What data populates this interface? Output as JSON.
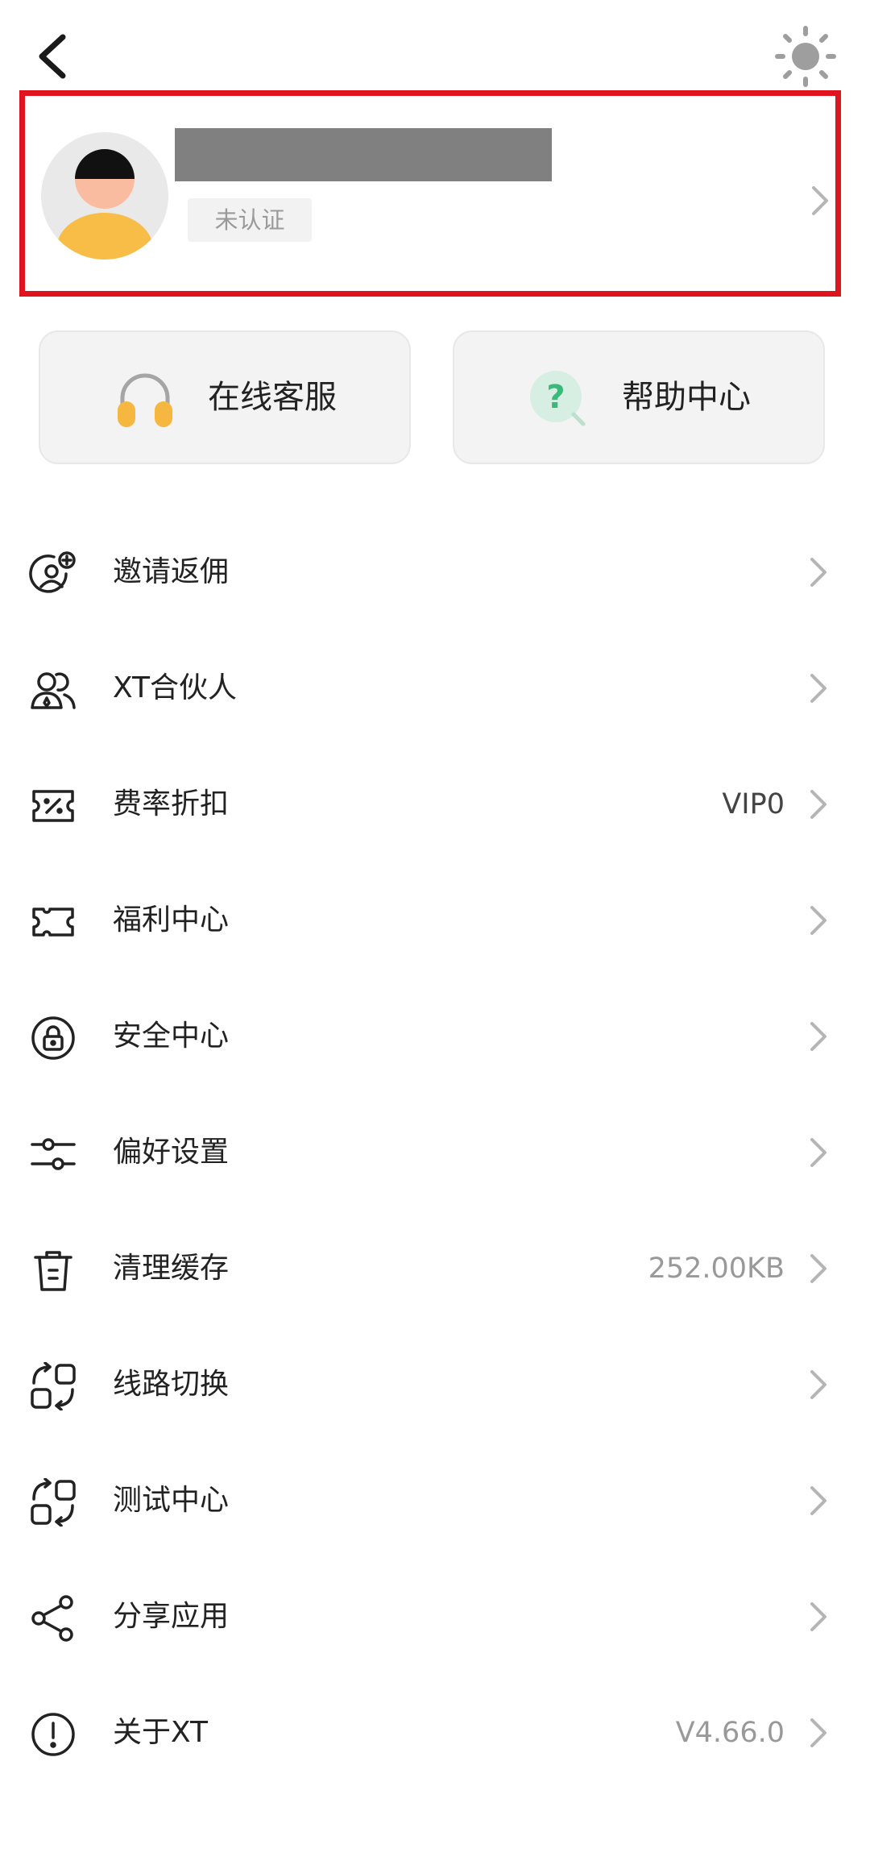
{
  "header": {
    "back_icon": "chevron-left-icon",
    "theme_icon": "sun-icon"
  },
  "profile": {
    "avatar_icon": "default-avatar",
    "verification_status": "未认证"
  },
  "quick_actions": {
    "service": {
      "label": "在线客服",
      "icon": "headset-icon"
    },
    "help": {
      "label": "帮助中心",
      "icon": "help-question-icon"
    }
  },
  "menu": {
    "items": [
      {
        "label": "邀请返佣",
        "value": "",
        "icon": "invite-user-icon"
      },
      {
        "label": "XT合伙人",
        "value": "",
        "icon": "partners-icon"
      },
      {
        "label": "费率折扣",
        "value": "VIP0",
        "icon": "discount-ticket-icon"
      },
      {
        "label": "福利中心",
        "value": "",
        "icon": "coupon-icon"
      },
      {
        "label": "安全中心",
        "value": "",
        "icon": "lock-icon"
      },
      {
        "label": "偏好设置",
        "value": "",
        "icon": "sliders-icon"
      },
      {
        "label": "清理缓存",
        "value": "252.00KB",
        "icon": "trash-icon"
      },
      {
        "label": "线路切换",
        "value": "",
        "icon": "switch-route-icon"
      },
      {
        "label": "测试中心",
        "value": "",
        "icon": "switch-route-icon"
      },
      {
        "label": "分享应用",
        "value": "",
        "icon": "share-icon"
      },
      {
        "label": "关于XT",
        "value": "V4.66.0",
        "icon": "info-icon"
      }
    ]
  },
  "colors": {
    "highlight_border": "#e0141e",
    "avatar_body": "#f7bd47",
    "avatar_face": "#f9bca0",
    "headset": "#f5b73f",
    "help_green": "#39b97a",
    "icon_gray": "#9e9e9e",
    "vip_text": "#444444",
    "muted_text": "#999999"
  }
}
